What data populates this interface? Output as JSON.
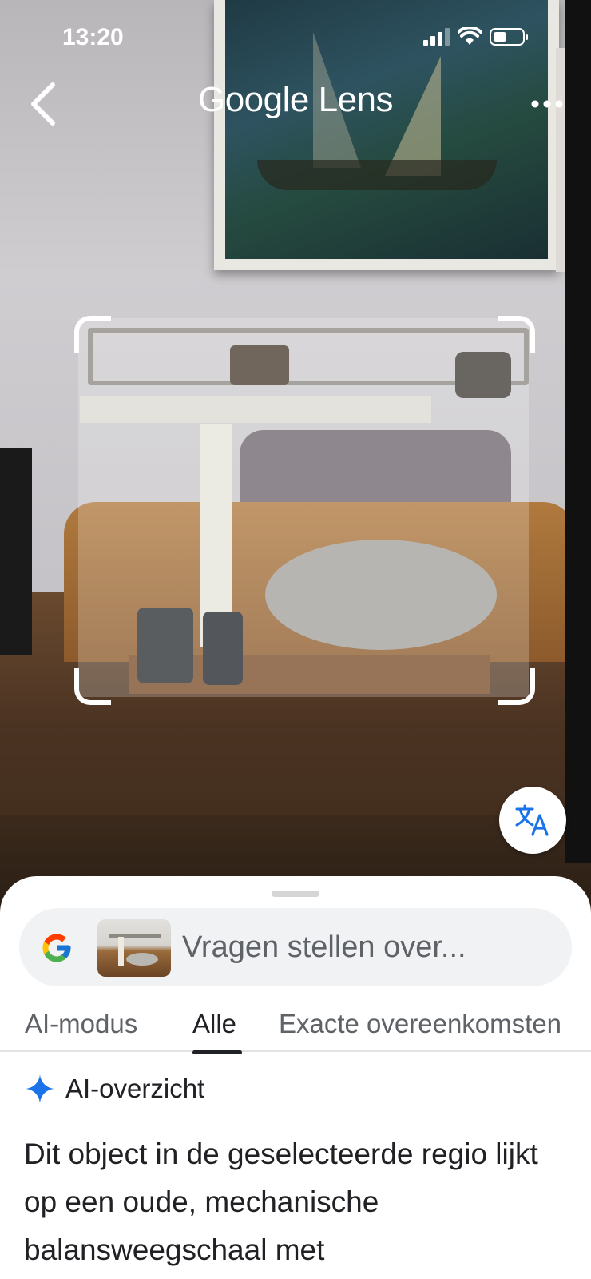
{
  "status_bar": {
    "time": "13:20"
  },
  "header": {
    "title": "Google Lens"
  },
  "search": {
    "placeholder": "Vragen stellen over..."
  },
  "tabs": [
    {
      "label": "AI-modus"
    },
    {
      "label": "Alle",
      "active": true
    },
    {
      "label": "Exacte overeenkomsten"
    }
  ],
  "ai_overview": {
    "label": "AI-overzicht",
    "text": "Dit object in de geselecteerde regio lijkt op een oude, mechanische balansweegschaal met"
  },
  "icons": {
    "back": "back-chevron-icon",
    "more": "more-options-icon",
    "translate": "translate-icon",
    "google": "google-g-icon",
    "sparkle": "ai-sparkle-icon"
  },
  "colors": {
    "accent_blue": "#1a73e8",
    "text_primary": "#202124",
    "text_secondary": "#5f6368",
    "searchbar_bg": "#f0f2f4"
  }
}
